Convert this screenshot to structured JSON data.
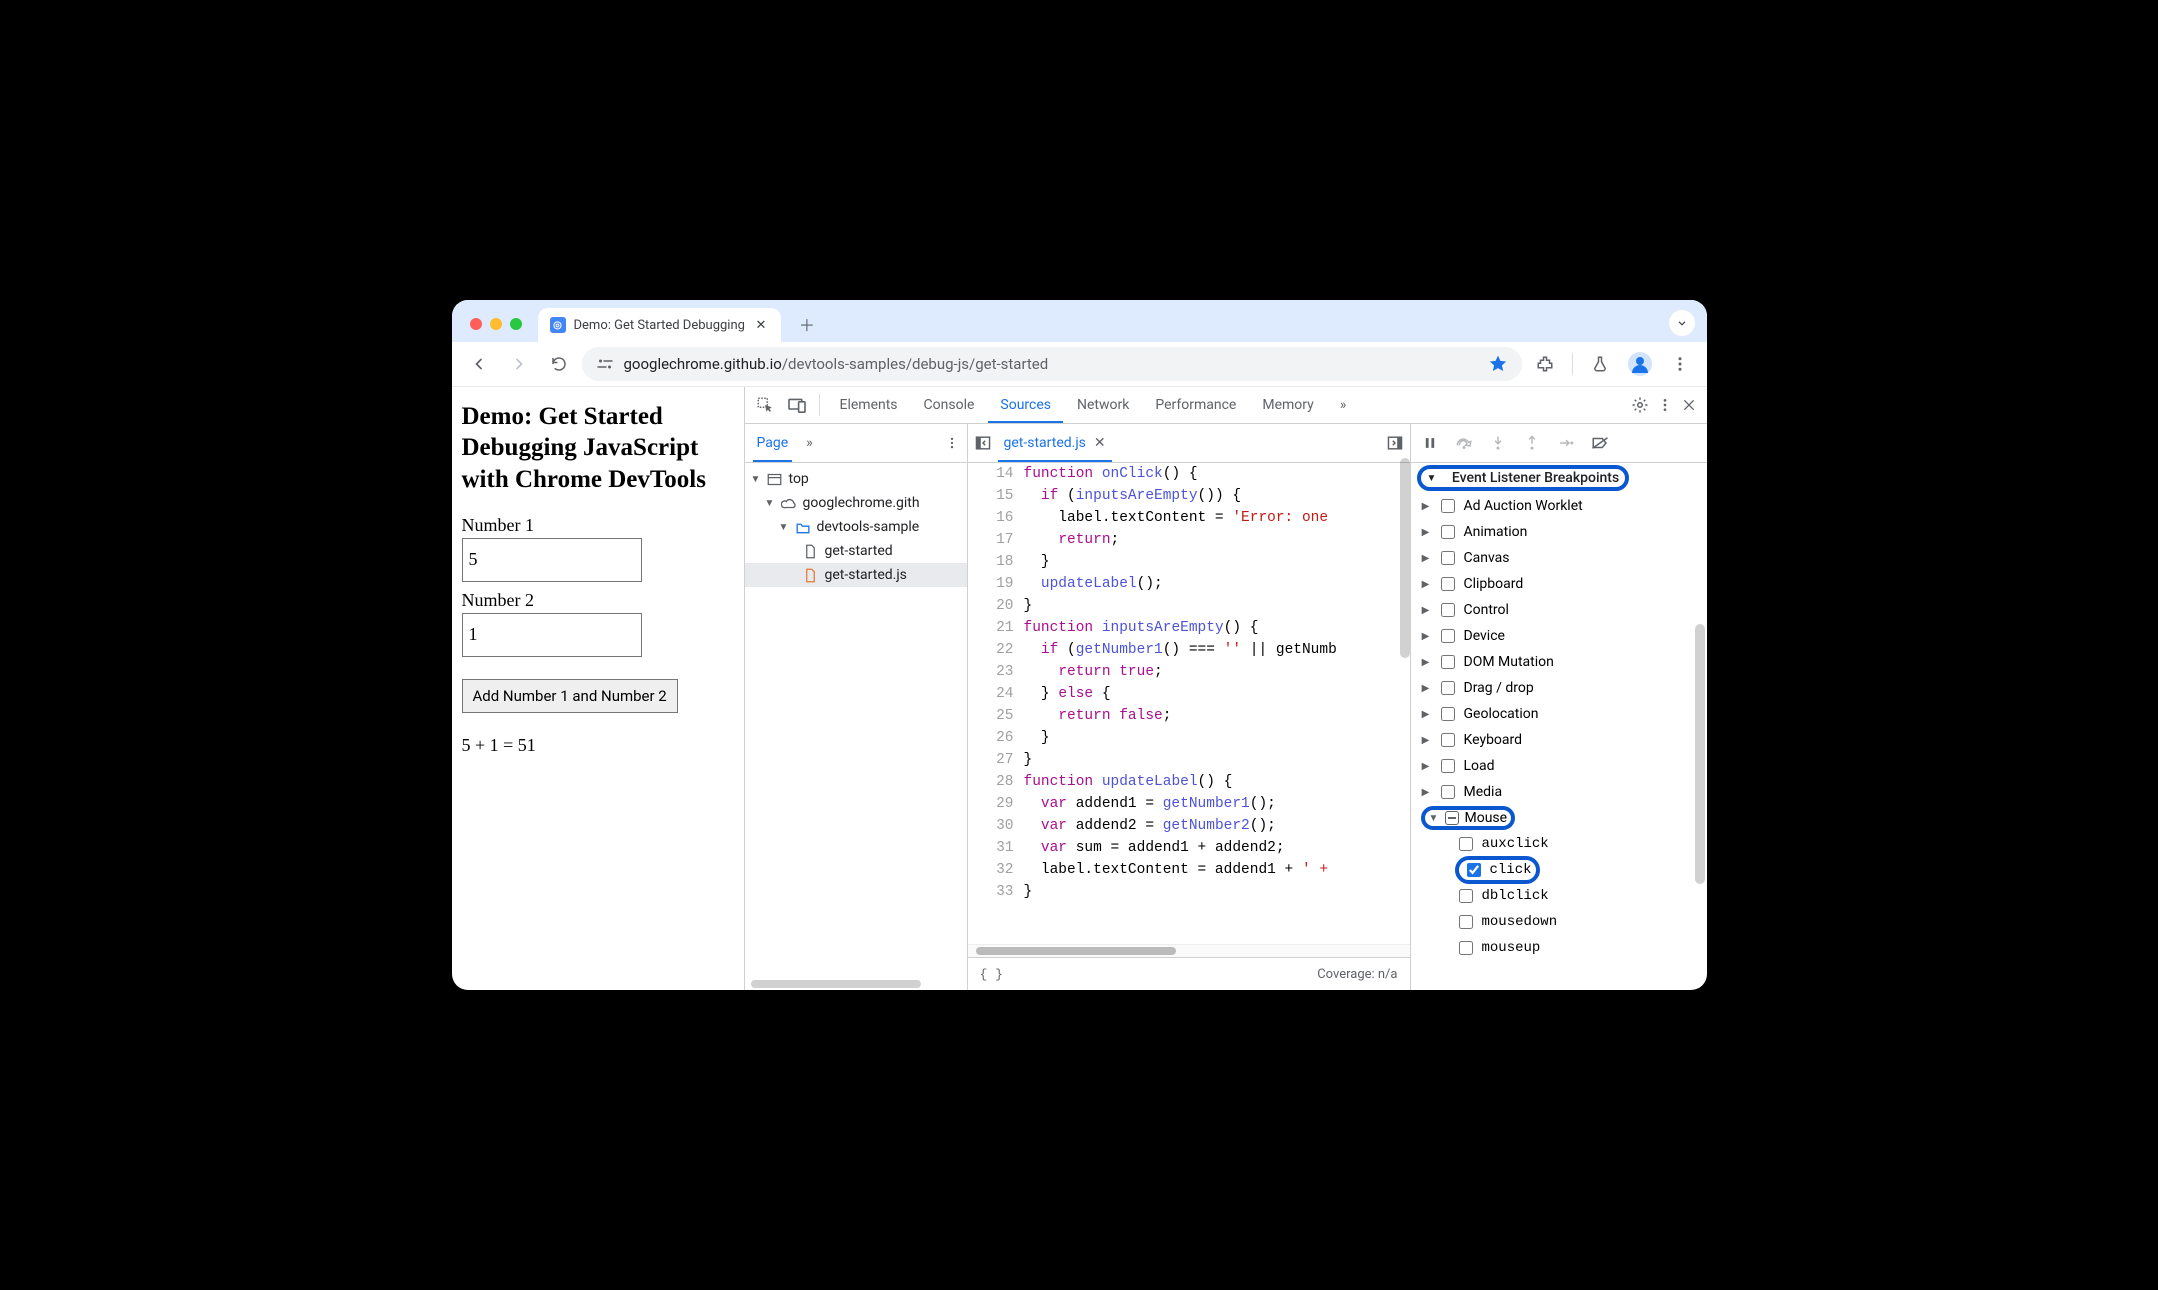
{
  "browser": {
    "tab_title": "Demo: Get Started Debugging",
    "url_host": "googlechrome.github.io",
    "url_path": "/devtools-samples/debug-js/get-started"
  },
  "page": {
    "heading": "Demo: Get Started Debugging JavaScript with Chrome DevTools",
    "label1": "Number 1",
    "value1": "5",
    "label2": "Number 2",
    "value2": "1",
    "button": "Add Number 1 and Number 2",
    "result": "5 + 1 = 51"
  },
  "devtools": {
    "tabs": [
      "Elements",
      "Console",
      "Sources",
      "Network",
      "Performance",
      "Memory"
    ],
    "active_tab": "Sources",
    "navigator": {
      "tab": "Page",
      "tree": {
        "top": "top",
        "origin": "googlechrome.gith",
        "folder": "devtools-sample",
        "files": [
          "get-started",
          "get-started.js"
        ],
        "selected": "get-started.js"
      }
    },
    "editor": {
      "file": "get-started.js",
      "first_line": 14,
      "lines": [
        "function onClick() {",
        "  if (inputsAreEmpty()) {",
        "    label.textContent = 'Error: one",
        "    return;",
        "  }",
        "  updateLabel();",
        "}",
        "function inputsAreEmpty() {",
        "  if (getNumber1() === '' || getNumb",
        "    return true;",
        "  } else {",
        "    return false;",
        "  }",
        "}",
        "function updateLabel() {",
        "  var addend1 = getNumber1();",
        "  var addend2 = getNumber2();",
        "  var sum = addend1 + addend2;",
        "  label.textContent = addend1 + ' +",
        "}"
      ],
      "coverage": "Coverage: n/a"
    },
    "breakpoints": {
      "section_title": "Event Listener Breakpoints",
      "categories": [
        {
          "label": "Ad Auction Worklet",
          "expanded": false,
          "checked": false
        },
        {
          "label": "Animation",
          "expanded": false,
          "checked": false
        },
        {
          "label": "Canvas",
          "expanded": false,
          "checked": false
        },
        {
          "label": "Clipboard",
          "expanded": false,
          "checked": false
        },
        {
          "label": "Control",
          "expanded": false,
          "checked": false
        },
        {
          "label": "Device",
          "expanded": false,
          "checked": false
        },
        {
          "label": "DOM Mutation",
          "expanded": false,
          "checked": false
        },
        {
          "label": "Drag / drop",
          "expanded": false,
          "checked": false
        },
        {
          "label": "Geolocation",
          "expanded": false,
          "checked": false
        },
        {
          "label": "Keyboard",
          "expanded": false,
          "checked": false
        },
        {
          "label": "Load",
          "expanded": false,
          "checked": false
        },
        {
          "label": "Media",
          "expanded": false,
          "checked": false
        },
        {
          "label": "Mouse",
          "expanded": true,
          "checked": "mixed",
          "highlighted": true,
          "children": [
            {
              "label": "auxclick",
              "checked": false
            },
            {
              "label": "click",
              "checked": true,
              "highlighted": true
            },
            {
              "label": "dblclick",
              "checked": false
            },
            {
              "label": "mousedown",
              "checked": false
            },
            {
              "label": "mouseup",
              "checked": false
            }
          ]
        }
      ]
    }
  }
}
